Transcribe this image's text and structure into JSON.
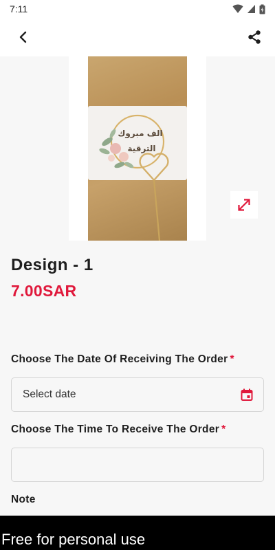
{
  "status_bar": {
    "time": "7:11",
    "icons": [
      "wifi-icon",
      "signal-icon",
      "battery-icon"
    ]
  },
  "app_bar": {
    "back_icon": "back-arrow-icon",
    "share_icon": "share-icon"
  },
  "gallery": {
    "card_text_line1": "الف مبروك",
    "card_text_line2": "الترقية",
    "expand_icon": "expand-icon"
  },
  "product": {
    "title": "Design - 1",
    "price": "7.00SAR"
  },
  "form": {
    "date_label": "Choose The Date Of Receiving The Order",
    "date_required": "*",
    "date_placeholder": "Select date",
    "date_icon": "calendar-icon",
    "time_label": "Choose The Time To Receive The Order",
    "time_required": "*",
    "time_value": "",
    "note_label": "Note"
  },
  "watermark": {
    "text": "Free for personal use"
  },
  "colors": {
    "accent": "#e0183b",
    "background": "#f7f7f7",
    "text": "#1e1e1e"
  }
}
